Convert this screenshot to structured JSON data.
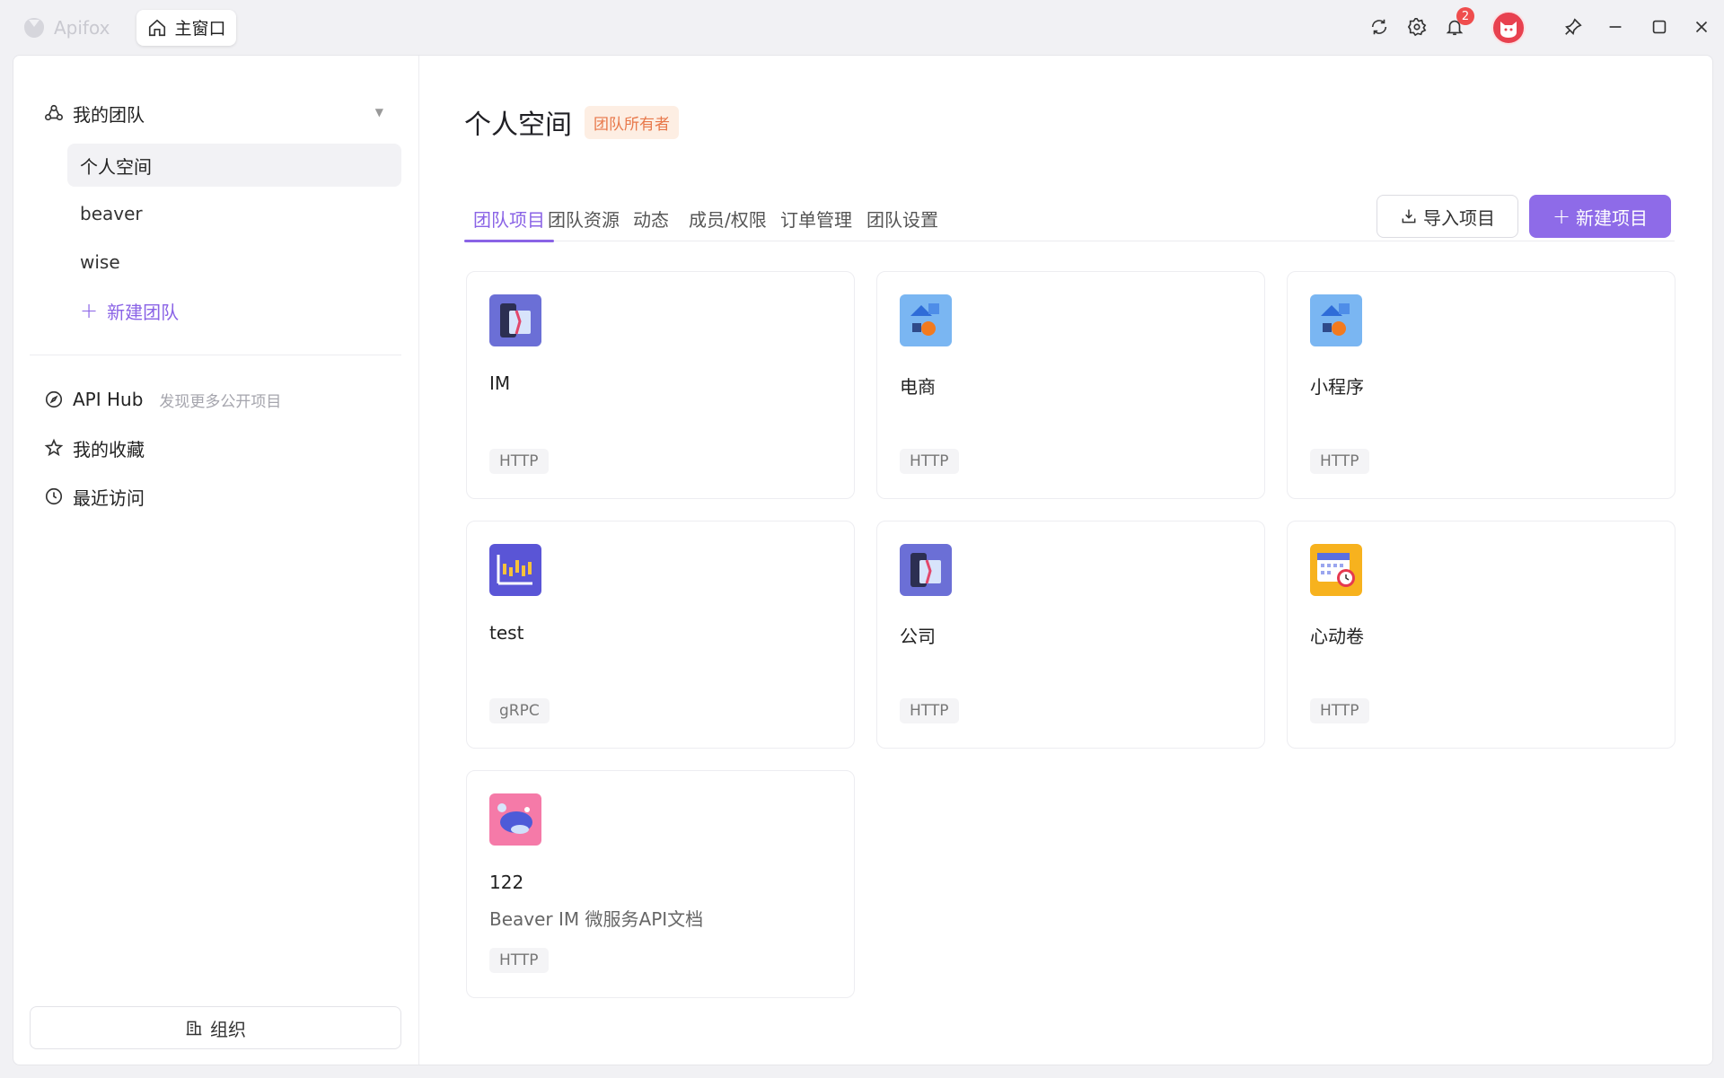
{
  "titlebar": {
    "brand": "Apifox",
    "home_tab": "主窗口",
    "notification_count": "2"
  },
  "sidebar": {
    "team_header": "我的团队",
    "teams": [
      "个人空间",
      "beaver",
      "wise"
    ],
    "new_team": "新建团队",
    "links": {
      "api_hub": "API Hub",
      "api_hub_hint": "发现更多公开项目",
      "favorites": "我的收藏",
      "recent": "最近访问"
    },
    "org_button": "组织"
  },
  "main": {
    "title": "个人空间",
    "owner_tag": "团队所有者",
    "tabs": [
      "团队项目",
      "团队资源",
      "动态",
      "成员/权限",
      "订单管理",
      "团队设置"
    ],
    "import_button": "导入项目",
    "new_button": "新建项目",
    "projects": [
      {
        "name": "IM",
        "desc": "",
        "type": "HTTP",
        "icon": "suit-icon"
      },
      {
        "name": "电商",
        "desc": "",
        "type": "HTTP",
        "icon": "shapes-icon"
      },
      {
        "name": "小程序",
        "desc": "",
        "type": "HTTP",
        "icon": "shapes-icon"
      },
      {
        "name": "test",
        "desc": "",
        "type": "gRPC",
        "icon": "chart-icon"
      },
      {
        "name": "公司",
        "desc": "",
        "type": "HTTP",
        "icon": "suit-icon"
      },
      {
        "name": "心动卷",
        "desc": "",
        "type": "HTTP",
        "icon": "calendar-icon"
      },
      {
        "name": "122",
        "desc": "Beaver IM 微服务API文档",
        "type": "HTTP",
        "icon": "cloud-icon"
      }
    ]
  },
  "colors": {
    "accent": "#8e6be8",
    "owner_tag_bg": "#fdeee3",
    "owner_tag_text": "#e8784a",
    "badge": "#ef4d4d",
    "avatar": "#e8414f"
  }
}
